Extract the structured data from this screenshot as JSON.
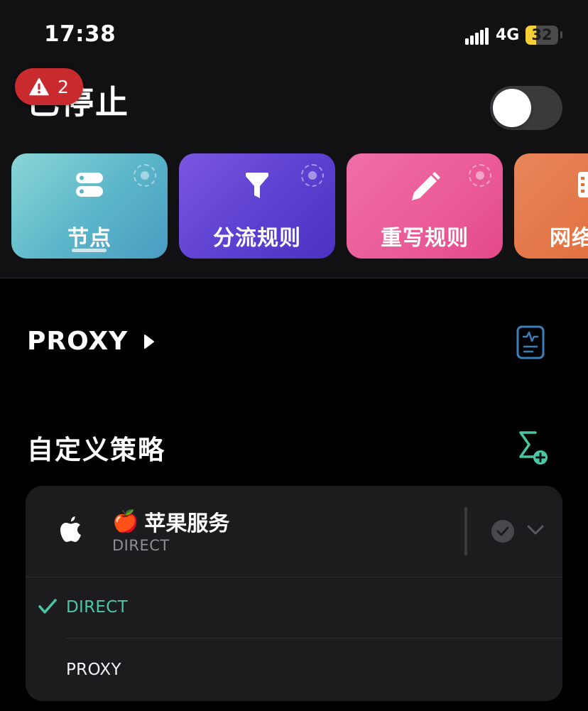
{
  "status_bar": {
    "time": "17:38",
    "network": "4G",
    "battery_level": "32",
    "battery_fraction": 0.32
  },
  "header": {
    "title": "已停止",
    "alert_count": "2",
    "vpn_enabled": false
  },
  "tiles": [
    {
      "label": "节点",
      "icon": "server-icon",
      "active": true
    },
    {
      "label": "分流规则",
      "icon": "funnel-icon",
      "active": false
    },
    {
      "label": "重写规则",
      "icon": "pencil-icon",
      "active": false
    },
    {
      "label": "网络",
      "icon": "list-icon",
      "active": false
    }
  ],
  "proxy": {
    "label": "PROXY",
    "arrow_icon": "play-icon",
    "action_icon": "monitor-icon"
  },
  "section": {
    "title": "自定义策略",
    "action_icon": "sigma-add-icon"
  },
  "policy_group": {
    "icon": "apple-logo-icon",
    "emoji": "🍎",
    "name": "苹果服务",
    "current": "DIRECT",
    "options": [
      {
        "label": "DIRECT",
        "selected": true
      },
      {
        "label": "PROXY",
        "selected": false
      }
    ]
  },
  "colors": {
    "accent_green": "#49c7a4",
    "alert_red": "#c92a2d",
    "battery_yellow": "#f5cf38"
  }
}
